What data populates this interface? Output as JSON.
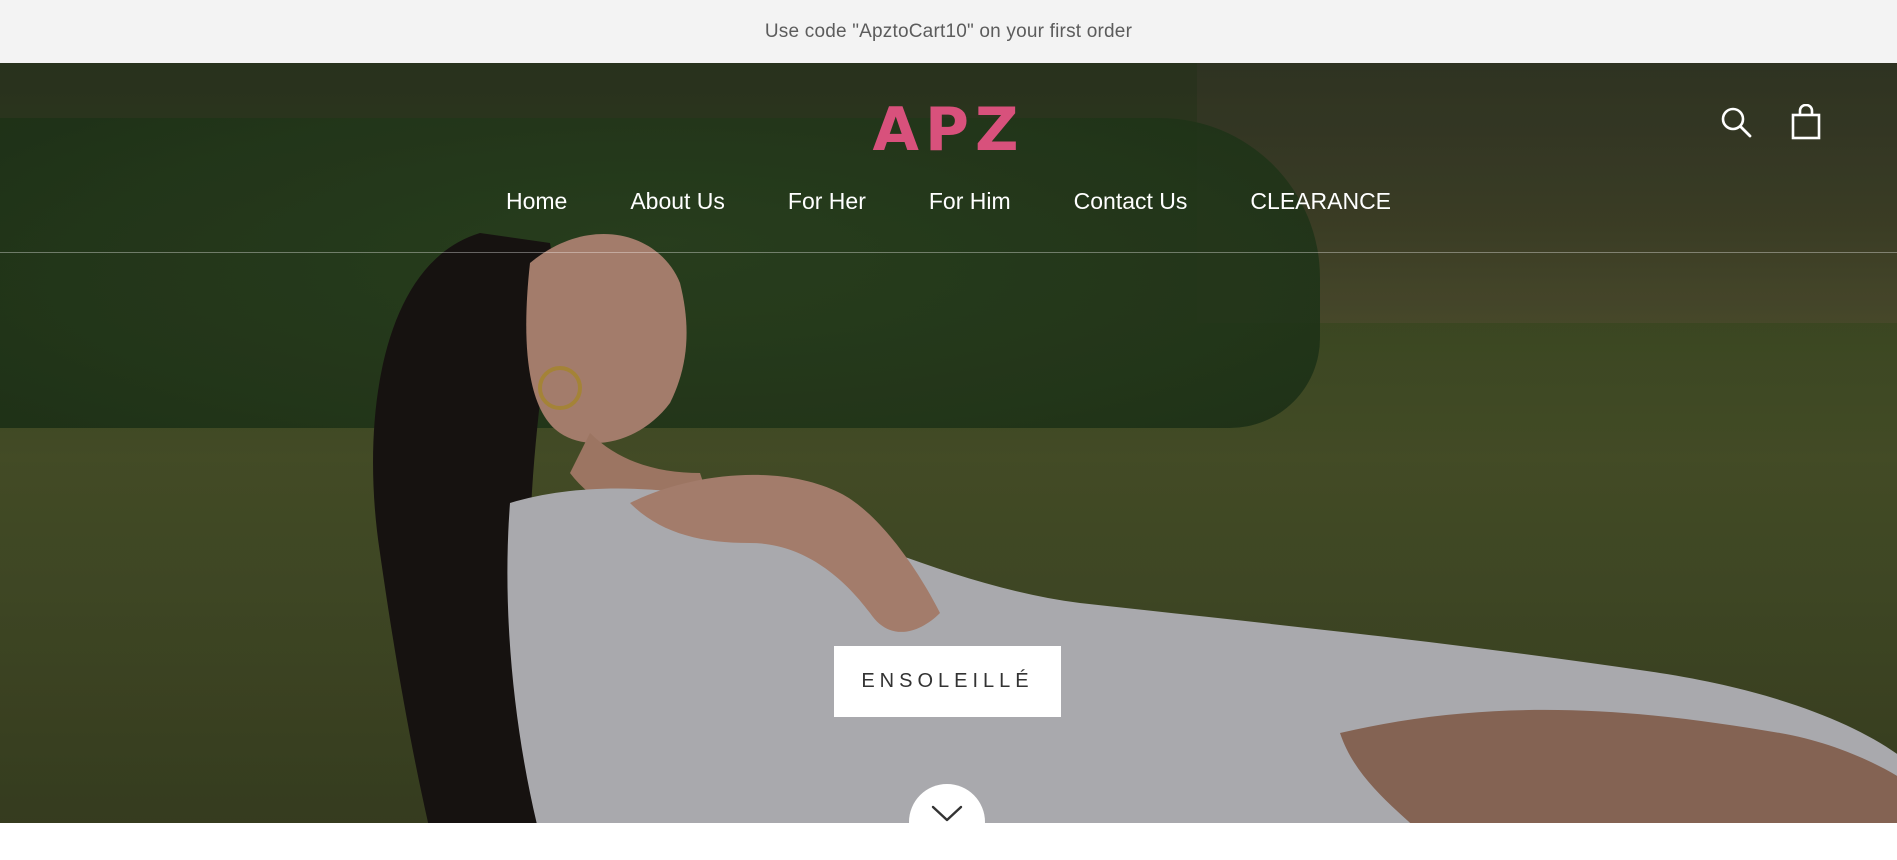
{
  "announcement": {
    "text": "Use code \"ApztoCart10\" on your first order"
  },
  "header": {
    "logo_text": "APZ",
    "brand_color": "#d8517c",
    "icons": [
      "search-icon",
      "shopping-bag-icon"
    ]
  },
  "nav": {
    "items": [
      {
        "label": "Home"
      },
      {
        "label": "About Us"
      },
      {
        "label": "For Her"
      },
      {
        "label": "For Him"
      },
      {
        "label": "Contact Us"
      },
      {
        "label": "CLEARANCE"
      }
    ]
  },
  "hero": {
    "cta_label": "ENSOLEILLÉ",
    "scroll_icon": "chevron-down-icon"
  }
}
